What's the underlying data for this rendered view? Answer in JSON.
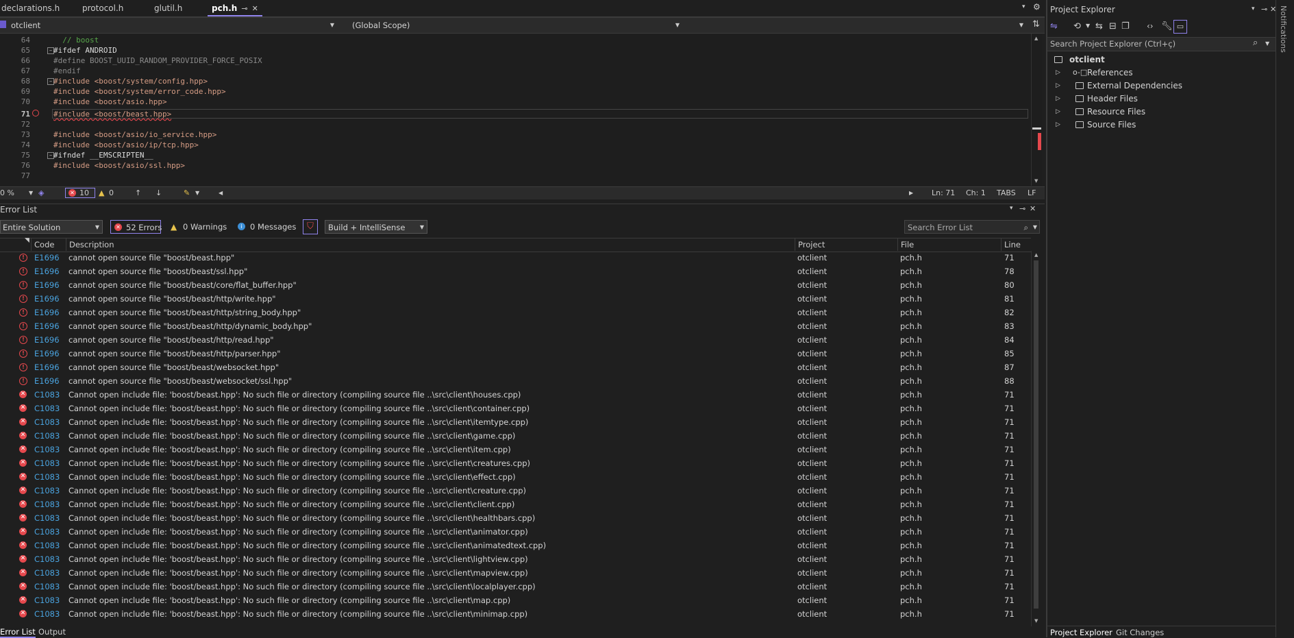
{
  "tabs": [
    {
      "label": "declarations.h",
      "active": false
    },
    {
      "label": "protocol.h",
      "active": false
    },
    {
      "label": "glutil.h",
      "active": false
    },
    {
      "label": "pch.h",
      "active": true
    }
  ],
  "nav": {
    "project": "otclient",
    "scope": "(Global Scope)",
    "member": ""
  },
  "editor": {
    "lines": [
      {
        "n": "64",
        "code": "  // boost"
      },
      {
        "n": "65",
        "code": "#ifdef ANDROID"
      },
      {
        "n": "66",
        "code": "#define BOOST_UUID_RANDOM_PROVIDER_FORCE_POSIX"
      },
      {
        "n": "67",
        "code": "#endif"
      },
      {
        "n": "68",
        "code": "#include <boost/system/config.hpp>"
      },
      {
        "n": "69",
        "code": "#include <boost/system/error_code.hpp>"
      },
      {
        "n": "70",
        "code": "#include <boost/asio.hpp>"
      },
      {
        "n": "71",
        "code": "#include <boost/beast.hpp>"
      },
      {
        "n": "72",
        "code": ""
      },
      {
        "n": "73",
        "code": "#include <boost/asio/io_service.hpp>"
      },
      {
        "n": "74",
        "code": "#include <boost/asio/ip/tcp.hpp>"
      },
      {
        "n": "75",
        "code": "#ifndef __EMSCRIPTEN__"
      },
      {
        "n": "76",
        "code": "#include <boost/asio/ssl.hpp>"
      },
      {
        "n": "77",
        "code": ""
      }
    ]
  },
  "editor_status": {
    "zoom": "0 %",
    "errors": "10",
    "warnings": "0",
    "ln": "Ln: 71",
    "ch": "Ch: 1",
    "tabs": "TABS",
    "eol": "LF"
  },
  "error_list": {
    "title": "Error List",
    "scope": "Entire Solution",
    "errors_btn": "52 Errors",
    "warnings_btn": "0 Warnings",
    "messages_btn": "0 Messages",
    "build_filter": "Build + IntelliSense",
    "search_placeholder": "Search Error List",
    "columns": {
      "code": "Code",
      "description": "Description",
      "project": "Project",
      "file": "File",
      "line": "Line"
    },
    "rows": [
      {
        "code": "E1696",
        "desc": "cannot open source file \"boost/beast.hpp\"",
        "project": "otclient",
        "file": "pch.h",
        "line": "71"
      },
      {
        "code": "E1696",
        "desc": "cannot open source file \"boost/beast/ssl.hpp\"",
        "project": "otclient",
        "file": "pch.h",
        "line": "78"
      },
      {
        "code": "E1696",
        "desc": "cannot open source file \"boost/beast/core/flat_buffer.hpp\"",
        "project": "otclient",
        "file": "pch.h",
        "line": "80"
      },
      {
        "code": "E1696",
        "desc": "cannot open source file \"boost/beast/http/write.hpp\"",
        "project": "otclient",
        "file": "pch.h",
        "line": "81"
      },
      {
        "code": "E1696",
        "desc": "cannot open source file \"boost/beast/http/string_body.hpp\"",
        "project": "otclient",
        "file": "pch.h",
        "line": "82"
      },
      {
        "code": "E1696",
        "desc": "cannot open source file \"boost/beast/http/dynamic_body.hpp\"",
        "project": "otclient",
        "file": "pch.h",
        "line": "83"
      },
      {
        "code": "E1696",
        "desc": "cannot open source file \"boost/beast/http/read.hpp\"",
        "project": "otclient",
        "file": "pch.h",
        "line": "84"
      },
      {
        "code": "E1696",
        "desc": "cannot open source file \"boost/beast/http/parser.hpp\"",
        "project": "otclient",
        "file": "pch.h",
        "line": "85"
      },
      {
        "code": "E1696",
        "desc": "cannot open source file \"boost/beast/websocket.hpp\"",
        "project": "otclient",
        "file": "pch.h",
        "line": "87"
      },
      {
        "code": "E1696",
        "desc": "cannot open source file \"boost/beast/websocket/ssl.hpp\"",
        "project": "otclient",
        "file": "pch.h",
        "line": "88"
      },
      {
        "code": "C1083",
        "desc": "Cannot open include file: 'boost/beast.hpp': No such file or directory (compiling source file ..\\src\\client\\houses.cpp)",
        "project": "otclient",
        "file": "pch.h",
        "line": "71"
      },
      {
        "code": "C1083",
        "desc": "Cannot open include file: 'boost/beast.hpp': No such file or directory (compiling source file ..\\src\\client\\container.cpp)",
        "project": "otclient",
        "file": "pch.h",
        "line": "71"
      },
      {
        "code": "C1083",
        "desc": "Cannot open include file: 'boost/beast.hpp': No such file or directory (compiling source file ..\\src\\client\\itemtype.cpp)",
        "project": "otclient",
        "file": "pch.h",
        "line": "71"
      },
      {
        "code": "C1083",
        "desc": "Cannot open include file: 'boost/beast.hpp': No such file or directory (compiling source file ..\\src\\client\\game.cpp)",
        "project": "otclient",
        "file": "pch.h",
        "line": "71"
      },
      {
        "code": "C1083",
        "desc": "Cannot open include file: 'boost/beast.hpp': No such file or directory (compiling source file ..\\src\\client\\item.cpp)",
        "project": "otclient",
        "file": "pch.h",
        "line": "71"
      },
      {
        "code": "C1083",
        "desc": "Cannot open include file: 'boost/beast.hpp': No such file or directory (compiling source file ..\\src\\client\\creatures.cpp)",
        "project": "otclient",
        "file": "pch.h",
        "line": "71"
      },
      {
        "code": "C1083",
        "desc": "Cannot open include file: 'boost/beast.hpp': No such file or directory (compiling source file ..\\src\\client\\effect.cpp)",
        "project": "otclient",
        "file": "pch.h",
        "line": "71"
      },
      {
        "code": "C1083",
        "desc": "Cannot open include file: 'boost/beast.hpp': No such file or directory (compiling source file ..\\src\\client\\creature.cpp)",
        "project": "otclient",
        "file": "pch.h",
        "line": "71"
      },
      {
        "code": "C1083",
        "desc": "Cannot open include file: 'boost/beast.hpp': No such file or directory (compiling source file ..\\src\\client\\client.cpp)",
        "project": "otclient",
        "file": "pch.h",
        "line": "71"
      },
      {
        "code": "C1083",
        "desc": "Cannot open include file: 'boost/beast.hpp': No such file or directory (compiling source file ..\\src\\client\\healthbars.cpp)",
        "project": "otclient",
        "file": "pch.h",
        "line": "71"
      },
      {
        "code": "C1083",
        "desc": "Cannot open include file: 'boost/beast.hpp': No such file or directory (compiling source file ..\\src\\client\\animator.cpp)",
        "project": "otclient",
        "file": "pch.h",
        "line": "71"
      },
      {
        "code": "C1083",
        "desc": "Cannot open include file: 'boost/beast.hpp': No such file or directory (compiling source file ..\\src\\client\\animatedtext.cpp)",
        "project": "otclient",
        "file": "pch.h",
        "line": "71"
      },
      {
        "code": "C1083",
        "desc": "Cannot open include file: 'boost/beast.hpp': No such file or directory (compiling source file ..\\src\\client\\lightview.cpp)",
        "project": "otclient",
        "file": "pch.h",
        "line": "71"
      },
      {
        "code": "C1083",
        "desc": "Cannot open include file: 'boost/beast.hpp': No such file or directory (compiling source file ..\\src\\client\\mapview.cpp)",
        "project": "otclient",
        "file": "pch.h",
        "line": "71"
      },
      {
        "code": "C1083",
        "desc": "Cannot open include file: 'boost/beast.hpp': No such file or directory (compiling source file ..\\src\\client\\localplayer.cpp)",
        "project": "otclient",
        "file": "pch.h",
        "line": "71"
      },
      {
        "code": "C1083",
        "desc": "Cannot open include file: 'boost/beast.hpp': No such file or directory (compiling source file ..\\src\\client\\map.cpp)",
        "project": "otclient",
        "file": "pch.h",
        "line": "71"
      },
      {
        "code": "C1083",
        "desc": "Cannot open include file: 'boost/beast.hpp': No such file or directory (compiling source file ..\\src\\client\\minimap.cpp)",
        "project": "otclient",
        "file": "pch.h",
        "line": "71"
      }
    ],
    "bottom_tabs": [
      "Error List",
      "Output"
    ]
  },
  "project_explorer": {
    "title": "Project Explorer",
    "search_placeholder": "Search Project Explorer (Ctrl+ç)",
    "root": "otclient",
    "items": [
      "References",
      "External Dependencies",
      "Header Files",
      "Resource Files",
      "Source Files"
    ],
    "bottom_tabs": [
      "Project Explorer",
      "Git Changes"
    ]
  },
  "side_strip": {
    "label": "Notifications"
  },
  "colors": {
    "accent": "#9184ee",
    "error": "#e5484d",
    "code_link": "#4aa3df"
  }
}
